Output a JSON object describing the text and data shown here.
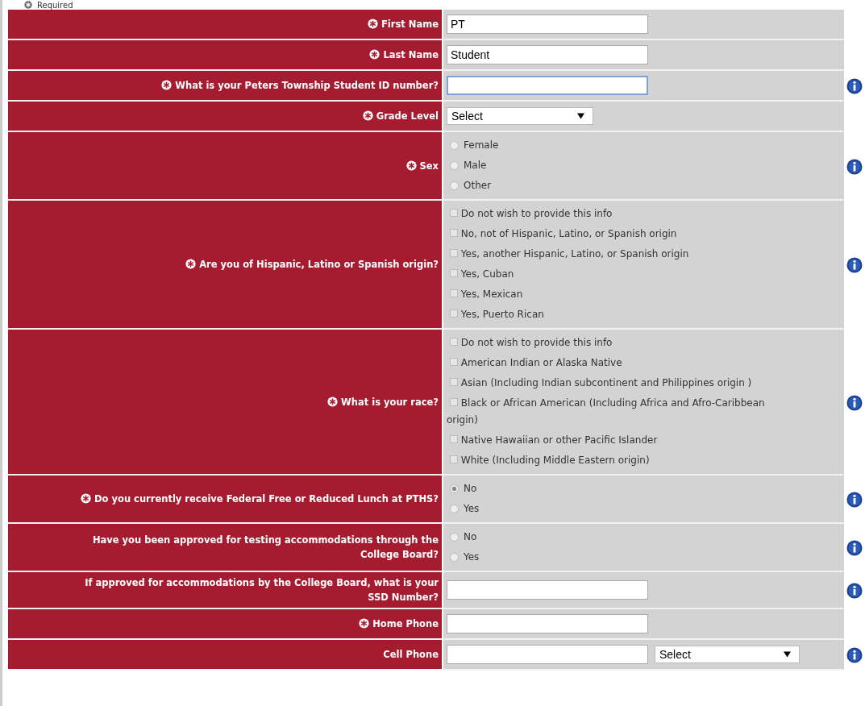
{
  "legend": {
    "label": "Required"
  },
  "rows": [
    {
      "label": "First Name",
      "required": true,
      "info": false,
      "kind": "text",
      "value": "PT"
    },
    {
      "label": "Last Name",
      "required": true,
      "info": false,
      "kind": "text",
      "value": "Student"
    },
    {
      "label": "What is your Peters Township Student ID number?",
      "required": true,
      "info": true,
      "kind": "text",
      "value": "",
      "focused": true
    },
    {
      "label": "Grade Level",
      "required": true,
      "info": false,
      "kind": "select",
      "value": "Select"
    },
    {
      "label": "Sex",
      "required": true,
      "info": true,
      "kind": "radio",
      "options": [
        {
          "label": "Female",
          "selected": false
        },
        {
          "label": "Male",
          "selected": false
        },
        {
          "label": "Other",
          "selected": false
        }
      ]
    },
    {
      "label": "Are you of Hispanic, Latino or Spanish origin?",
      "required": true,
      "info": true,
      "kind": "checkbox",
      "options": [
        {
          "label": "Do not wish to provide this info",
          "checked": false
        },
        {
          "label": "No, not of Hispanic, Latino, or Spanish origin",
          "checked": false
        },
        {
          "label": "Yes, another Hispanic, Latino, or Spanish origin",
          "checked": false
        },
        {
          "label": "Yes, Cuban",
          "checked": false
        },
        {
          "label": "Yes, Mexican",
          "checked": false
        },
        {
          "label": "Yes, Puerto Rican",
          "checked": false
        }
      ]
    },
    {
      "label": "What is your race?",
      "required": true,
      "info": true,
      "kind": "checkbox",
      "options": [
        {
          "label": "Do not wish to provide this info",
          "checked": false
        },
        {
          "label": "American Indian or Alaska Native",
          "checked": false
        },
        {
          "label": "Asian (Including Indian subcontinent and Philippines origin )",
          "checked": false
        },
        {
          "label": "Black or African American (Including Africa and Afro-Caribbean origin)",
          "checked": false
        },
        {
          "label": "Native Hawaiian or other Pacific Islander",
          "checked": false
        },
        {
          "label": "White (Including Middle Eastern origin)",
          "checked": false
        }
      ]
    },
    {
      "label": "Do you currently receive Federal Free or Reduced Lunch at PTHS?",
      "required": true,
      "info": true,
      "kind": "radio",
      "options": [
        {
          "label": "No",
          "selected": true
        },
        {
          "label": "Yes",
          "selected": false
        }
      ]
    },
    {
      "label": "Have you been approved for testing accommodations through the College Board?",
      "required": false,
      "info": true,
      "kind": "radio",
      "options": [
        {
          "label": "No",
          "selected": false
        },
        {
          "label": "Yes",
          "selected": false
        }
      ]
    },
    {
      "label": "If approved for accommodations by the College Board, what is your SSD Number?",
      "required": false,
      "info": true,
      "kind": "text",
      "value": ""
    },
    {
      "label": "Home Phone",
      "required": true,
      "info": false,
      "kind": "text",
      "value": ""
    },
    {
      "label": "Cell Phone",
      "required": false,
      "info": true,
      "kind": "phone",
      "value": "",
      "select": "Select"
    }
  ]
}
